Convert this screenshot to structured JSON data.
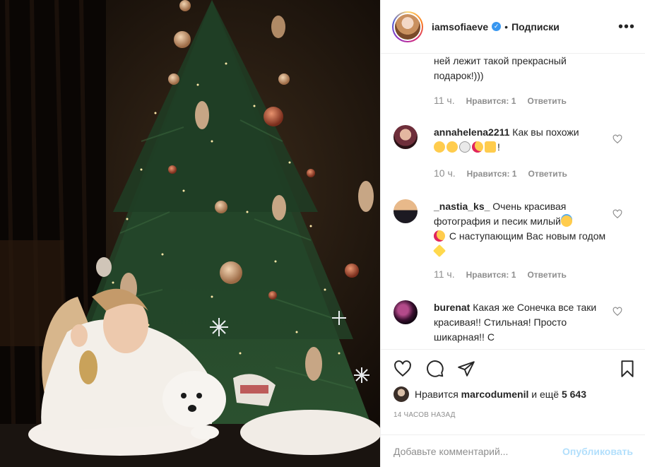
{
  "post": {
    "photo_alt": ""
  },
  "header": {
    "username": "iamsofiaeve",
    "separator": "•",
    "follow_label": "Подписки",
    "more_label": "•••",
    "verified_mark": "✓"
  },
  "comments": [
    {
      "username": "",
      "text": "ней лежит такой прекрасный подарок!)))",
      "time": "11 ч.",
      "likes": "Нравится: 1",
      "reply": "Ответить"
    },
    {
      "username": "annahelena2211",
      "text": "Как вы похожи",
      "trailing": "!",
      "time": "10 ч.",
      "likes": "Нравится: 1",
      "reply": "Ответить"
    },
    {
      "username": "_nastia_ks_",
      "text": "Очень красивая фотография и песик милый",
      "text2": "С наступающим Вас новым годом",
      "time": "11 ч.",
      "likes": "Нравится: 1",
      "reply": "Ответить"
    },
    {
      "username": "burenat",
      "text": "Какая же Сонечка все таки красивая!! Стильная! Просто шикарная!! С"
    }
  ],
  "likes": {
    "prefix": "Нравится",
    "user": "marcodumenil",
    "conj": "и ещё",
    "count": "5 643"
  },
  "timestamp": "14 часов назад",
  "add_comment": {
    "placeholder": "Добавьте комментарий...",
    "publish_label": "Опубликовать"
  },
  "colors": {
    "accent": "#3897f0",
    "publish_disabled": "#b2dffc",
    "meta": "#8e8e8e",
    "text": "#262626"
  }
}
